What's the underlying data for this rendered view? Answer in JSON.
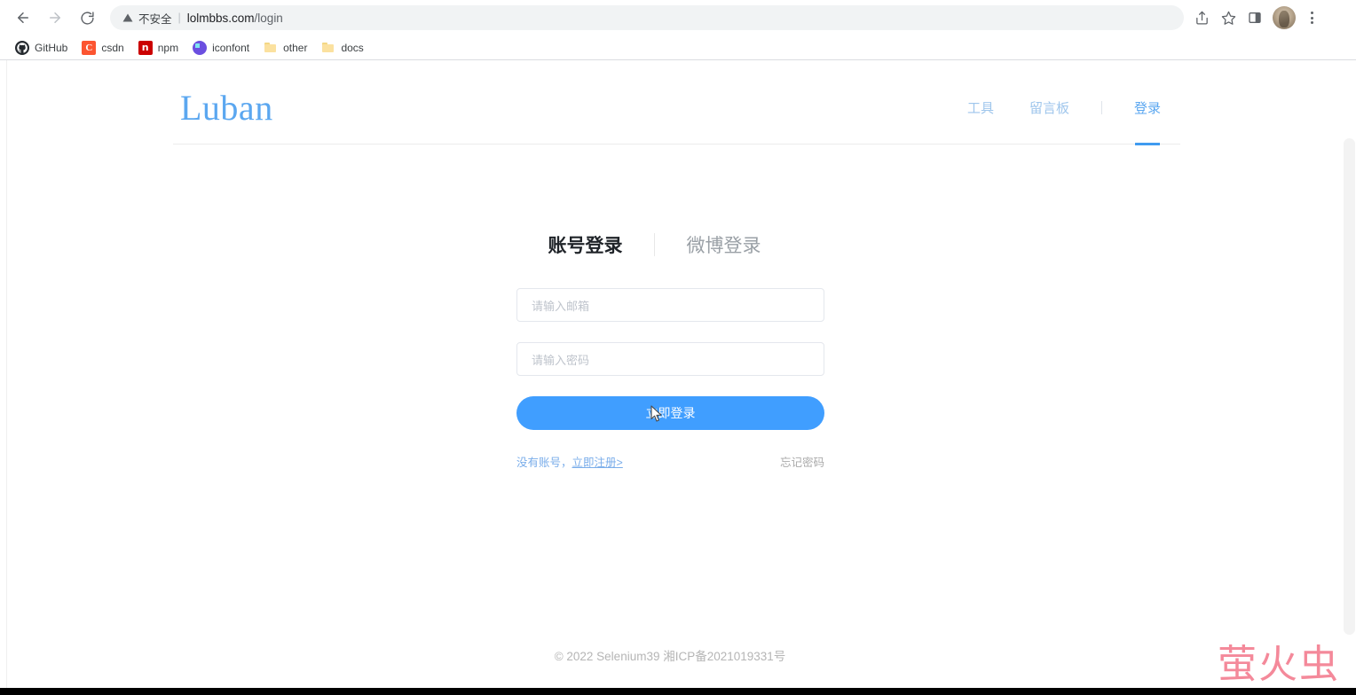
{
  "browser": {
    "back_label": "back-arrow",
    "forward_label": "forward-arrow",
    "reload_label": "reload",
    "omnibox": {
      "security_icon": "warning-triangle-icon",
      "security_text": "不安全",
      "separator": "|",
      "url_host": "lolmbbs.com",
      "url_path": "/login",
      "full_url": "lolmbbs.com/login"
    },
    "actions": {
      "share_label": "share-icon",
      "bookmark_label": "star-icon",
      "sidepanel_label": "side-panel-icon",
      "profile_label": "profile-avatar",
      "menu_label": "three-dot-menu"
    },
    "bookmarks": [
      {
        "label": "GitHub",
        "icon": "github-icon",
        "glyph": "●"
      },
      {
        "label": "csdn",
        "icon": "csdn-icon",
        "glyph": "C"
      },
      {
        "label": "npm",
        "icon": "npm-icon",
        "glyph": "n"
      },
      {
        "label": "iconfont",
        "icon": "iconfont-icon",
        "glyph": ""
      },
      {
        "label": "other",
        "icon": "folder-icon",
        "glyph": ""
      },
      {
        "label": "docs",
        "icon": "folder-icon",
        "glyph": ""
      }
    ]
  },
  "site": {
    "logo": "Luban",
    "nav": [
      {
        "label": "工具",
        "active": false
      },
      {
        "label": "留言板",
        "active": false
      },
      {
        "label": "登录",
        "active": true
      }
    ]
  },
  "login": {
    "tabs": [
      {
        "label": "账号登录",
        "active": true
      },
      {
        "label": "微博登录",
        "active": false
      }
    ],
    "email_placeholder": "请输入邮箱",
    "password_placeholder": "请输入密码",
    "submit_label": "立即登录",
    "register_prefix": "没有账号，",
    "register_link": "立即注册>",
    "forgot_label": "忘记密码",
    "accent_color": "#409eff"
  },
  "footer": {
    "text": "© 2022 Selenium39 湘ICP备2021019331号"
  },
  "watermark": {
    "text": "萤火虫",
    "color": "#f4899a"
  }
}
